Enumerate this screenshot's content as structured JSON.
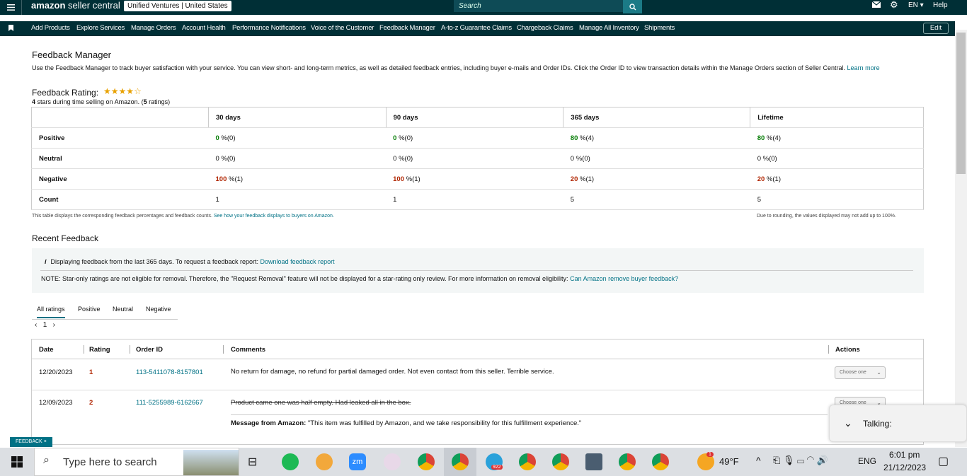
{
  "topbar": {
    "logo_brand": "amazon",
    "logo_suffix": "seller central",
    "store_name": "Unified Ventures",
    "store_region": "United States",
    "search_placeholder": "Search",
    "language": "EN",
    "help": "Help"
  },
  "nav": {
    "items": [
      "Add Products",
      "Explore Services",
      "Manage Orders",
      "Account Health",
      "Performance Notifications",
      "Voice of the Customer",
      "Feedback Manager",
      "A-to-z Guarantee Claims",
      "Chargeback Claims",
      "Manage All Inventory",
      "Shipments"
    ],
    "edit": "Edit"
  },
  "page": {
    "title": "Feedback Manager",
    "description": "Use the Feedback Manager to track buyer satisfaction with your service. You can view short- and long-term metrics, as well as detailed feedback entries, including buyer e-mails and Order IDs. Click the Order ID to view transaction details within the Manage Orders section of Seller Central.",
    "learn_more": "Learn more",
    "rating_title": "Feedback Rating:",
    "stars": 4,
    "stars_max": 5,
    "rating_sub_stars": "4",
    "rating_sub_text": " stars during time selling on Amazon. (",
    "rating_sub_count": "5",
    "rating_sub_end": " ratings)"
  },
  "metrics": {
    "headers": [
      "30 days",
      "90 days",
      "365 days",
      "Lifetime"
    ],
    "rows": [
      {
        "label": "Positive",
        "cells": [
          {
            "v": "0",
            "c": "(0)",
            "t": "green"
          },
          {
            "v": "0",
            "c": "(0)",
            "t": "green"
          },
          {
            "v": "80",
            "c": "(4)",
            "t": "green"
          },
          {
            "v": "80",
            "c": "(4)",
            "t": "green"
          }
        ]
      },
      {
        "label": "Neutral",
        "cells": [
          {
            "v": "0",
            "c": "(0)",
            "t": ""
          },
          {
            "v": "0",
            "c": "(0)",
            "t": ""
          },
          {
            "v": "0",
            "c": "(0)",
            "t": ""
          },
          {
            "v": "0",
            "c": "(0)",
            "t": ""
          }
        ]
      },
      {
        "label": "Negative",
        "cells": [
          {
            "v": "100",
            "c": "(1)",
            "t": "red"
          },
          {
            "v": "100",
            "c": "(1)",
            "t": "red"
          },
          {
            "v": "20",
            "c": "(1)",
            "t": "red"
          },
          {
            "v": "20",
            "c": "(1)",
            "t": "red"
          }
        ]
      },
      {
        "label": "Count",
        "cells": [
          {
            "v": "1",
            "c": "",
            "t": "plain"
          },
          {
            "v": "1",
            "c": "",
            "t": "plain"
          },
          {
            "v": "5",
            "c": "",
            "t": "plain"
          },
          {
            "v": "5",
            "c": "",
            "t": "plain"
          }
        ]
      }
    ],
    "note_left": "This table displays the corresponding feedback percentages and feedback counts.",
    "note_left_link": "See how your feedback displays to buyers on Amazon.",
    "note_right": "Due to rounding, the values displayed may not add up to 100%."
  },
  "recent": {
    "title": "Recent Feedback",
    "info_text": "Displaying feedback from the last 365 days. To request a feedback report:",
    "info_link": "Download feedback report",
    "note_text": "NOTE: Star-only ratings are not eligible for removal. Therefore, the \"Request Removal\" feature will not be displayed for a star-rating only review. For more information on removal eligibility:",
    "note_link": "Can Amazon remove buyer feedback?",
    "tabs": [
      "All ratings",
      "Positive",
      "Neutral",
      "Negative"
    ],
    "page": "1",
    "columns": [
      "Date",
      "Rating",
      "Order ID",
      "Comments",
      "Actions"
    ],
    "rows": [
      {
        "date": "12/20/2023",
        "rating": "1",
        "order": "113-5411078-8157801",
        "comment": "No return for damage, no refund for partial damaged order. Not even contact from this seller. Terrible service.",
        "action": "Choose one"
      },
      {
        "date": "12/09/2023",
        "rating": "2",
        "order": "111-5255989-6162667",
        "comment": "Product came one was half empty. Had leaked all in the box.",
        "action": "Choose one",
        "msg_label": "Message from Amazon:",
        "msg_text": "\"This item was fulfilled by Amazon, and we take responsibility for this fulfillment experience.\""
      }
    ]
  },
  "overlay": {
    "talking": "Talking:",
    "feedback": "FEEDBACK"
  },
  "taskbar": {
    "search": "Type here to search",
    "weather": "49°F",
    "lang": "ENG",
    "time": "6:01 pm",
    "date": "21/12/2023",
    "telegram_badge": "922",
    "weather_badge": "1"
  }
}
